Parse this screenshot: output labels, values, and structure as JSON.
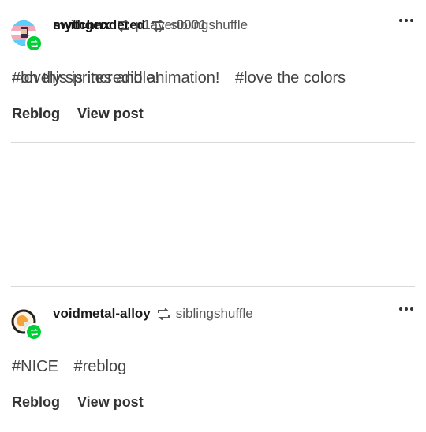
{
  "posts": [
    {
      "username": "switchnx",
      "source": "p1ayer0001",
      "tags": [
        "#oh this is incredible!"
      ],
      "actions": {
        "reblog": "Reblog",
        "view": "View post"
      }
    },
    {
      "username": "voidmetal-alloy",
      "source": "siblingshuffle",
      "tags": [
        "#NICE",
        "#reblog"
      ],
      "actions": {
        "reblog": "Reblog",
        "view": "View post"
      }
    },
    {
      "username": "mythgendered",
      "source": "siblingshuffle",
      "tags": [
        "#lovely sprites and animation!",
        "#love the colors"
      ],
      "actions": {
        "reblog": "Reblog",
        "view": "View post"
      }
    }
  ],
  "colors": {
    "reblog_green": "#00cf35",
    "divider": "#d9d9d9"
  },
  "icons": {
    "reblog": "reblog-icon",
    "more": "more-options-icon"
  }
}
